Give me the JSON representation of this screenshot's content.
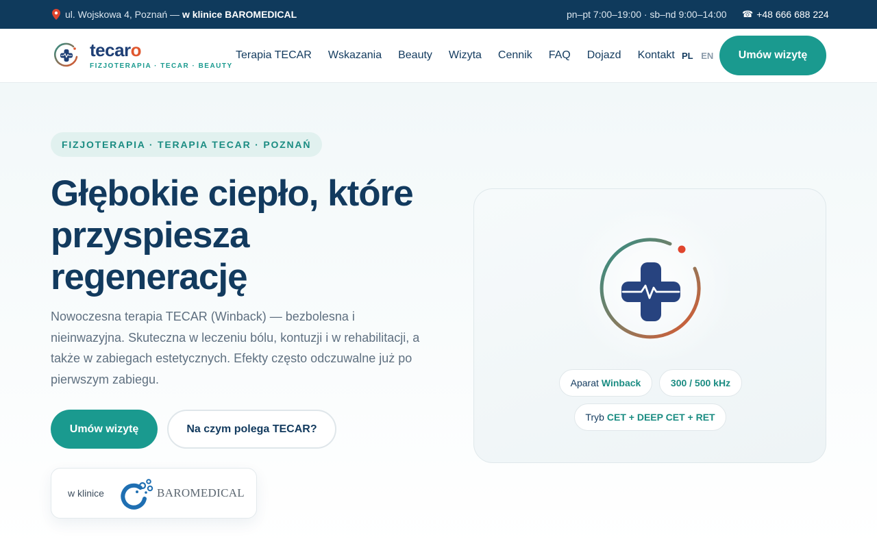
{
  "topbar": {
    "address": "ul. Wojskowa 4, Poznań —",
    "clinic": "w klinice BAROMEDICAL",
    "hours": "pn–pt 7:00–19:00 · sb–nd 9:00–14:00",
    "phone": "+48 666 688 224"
  },
  "header": {
    "logo_word_main": "tecar",
    "logo_word_accent": "o",
    "logo_tagline": "FIZJOTERAPIA · TECAR · BEAUTY",
    "nav": [
      "Terapia TECAR",
      "Wskazania",
      "Beauty",
      "Wizyta",
      "Cennik",
      "FAQ",
      "Dojazd",
      "Kontakt"
    ],
    "lang_pl": "PL",
    "lang_en": "EN",
    "cta_label": "Umów wizytę"
  },
  "hero": {
    "eyebrow": "FIZJOTERAPIA · TERAPIA TECAR · POZNAŃ",
    "title": "Głębokie ciepło, które przyspiesza regenerację",
    "description": "Nowoczesna terapia TECAR (Winback) — bezbolesna i nieinwazyjna. Skuteczna w leczeniu bólu, kontuzji i w rehabilitacji, a także w zabiegach estetycznych. Efekty często odczuwalne już po pierwszym zabiegu.",
    "primary_button": "Umów wizytę",
    "secondary_button": "Na czym polega TECAR?",
    "clinic_prefix": "w klinice",
    "clinic_name": "BAROMEDICAL"
  },
  "device": {
    "chip1_prefix": "Aparat",
    "chip1_value": "Winback",
    "chip2_value": "300 / 500 kHz",
    "chip3_prefix": "Tryb",
    "chip3_value": "CET + DEEP CET + RET"
  },
  "colors": {
    "navy": "#0f3a5c",
    "teal": "#1a9a8f",
    "orange": "#e0572e",
    "brand_blue": "#1e3f75"
  }
}
